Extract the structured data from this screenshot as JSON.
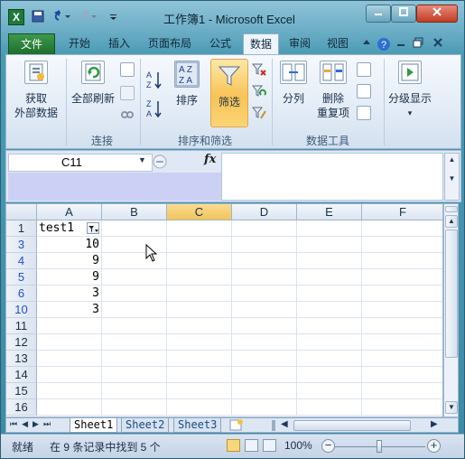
{
  "titlebar": {
    "app_icon": "X",
    "title": "工作簿1 - Microsoft Excel",
    "quick_access": [
      "save-icon",
      "undo-icon",
      "redo-icon",
      "customize-icon"
    ]
  },
  "menu": {
    "tabs": [
      "文件",
      "开始",
      "插入",
      "页面布局",
      "公式",
      "数据",
      "审阅",
      "视图"
    ],
    "active": "数据"
  },
  "ribbon": {
    "get_external": "获取\n外部数据",
    "get_external_l1": "获取",
    "get_external_l2": "外部数据",
    "refresh_all": "全部刷新",
    "connections_label": "连接",
    "sort": "排序",
    "filter": "筛选",
    "sort_filter_label": "排序和筛选",
    "text_to_columns": "分列",
    "remove_dup_l1": "删除",
    "remove_dup_l2": "重复项",
    "data_tools_label": "数据工具",
    "outline": "分级显示"
  },
  "formula_bar": {
    "name_box": "C11",
    "fx": "fx",
    "formula": ""
  },
  "grid": {
    "columns": [
      "A",
      "B",
      "C",
      "D",
      "E",
      "F"
    ],
    "selected_column": "C",
    "rows": [
      {
        "num": "1",
        "a": "test1",
        "filtered": false
      },
      {
        "num": "3",
        "a": "10",
        "filtered": true
      },
      {
        "num": "4",
        "a": "9",
        "filtered": true
      },
      {
        "num": "5",
        "a": "9",
        "filtered": true
      },
      {
        "num": "6",
        "a": "3",
        "filtered": true
      },
      {
        "num": "10",
        "a": "3",
        "filtered": true
      },
      {
        "num": "11",
        "a": "",
        "filtered": false
      },
      {
        "num": "12",
        "a": "",
        "filtered": false
      },
      {
        "num": "13",
        "a": "",
        "filtered": false
      },
      {
        "num": "14",
        "a": "",
        "filtered": false
      },
      {
        "num": "15",
        "a": "",
        "filtered": false
      },
      {
        "num": "16",
        "a": "",
        "filtered": false
      }
    ]
  },
  "sheets": {
    "tabs": [
      "Sheet1",
      "Sheet2",
      "Sheet3"
    ],
    "active": "Sheet1"
  },
  "status": {
    "mode": "就绪",
    "message": "在 9 条记录中找到 5 个",
    "zoom": "100%"
  },
  "colors": {
    "file_tab": "#2a8540",
    "filter_active": "#f8c356",
    "filtered_row_number": "#1f4fd1"
  }
}
